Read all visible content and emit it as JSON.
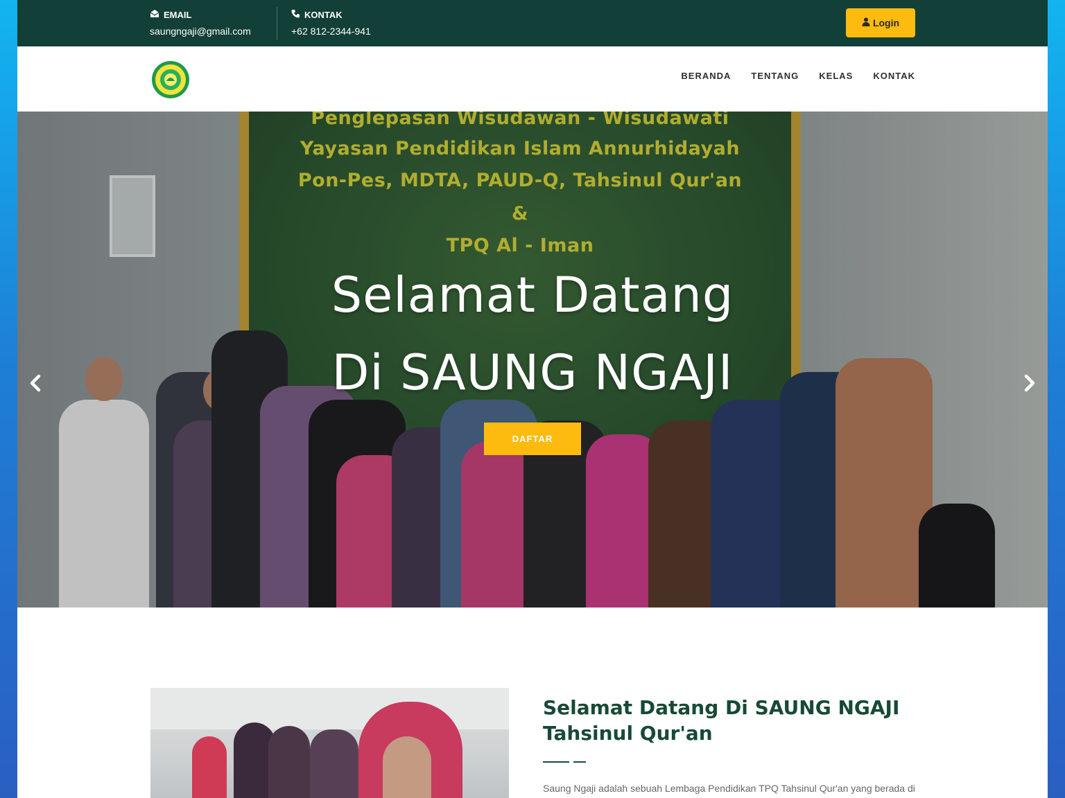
{
  "topbar": {
    "email_label": "EMAIL",
    "email_value": "saungngaji@gmail.com",
    "contact_label": "KONTAK",
    "contact_value": "+62 812-2344-941",
    "login_label": "Login"
  },
  "nav": {
    "items": [
      {
        "label": "BERANDA"
      },
      {
        "label": "TENTANG"
      },
      {
        "label": "KELAS"
      },
      {
        "label": "KONTAK"
      }
    ]
  },
  "hero": {
    "banner_lines": [
      "Penglepasan Wisudawan - Wisudawati",
      "Yayasan Pendidikan Islam Annurhidayah",
      "Pon-Pes, MDTA, PAUD-Q, Tahsinul Qur'an",
      "&",
      "TPQ Al - Iman"
    ],
    "title_line1": "Selamat Datang",
    "title_line2": "Di SAUNG NGAJI",
    "cta_label": "DAFTAR"
  },
  "about": {
    "title_line1": "Selamat Datang Di SAUNG NGAJI",
    "title_line2": "Tahsinul Qur'an",
    "text": "Saung Ngaji adalah sebuah Lembaga Pendidikan TPQ Tahsinul Qur'an yang berada di"
  },
  "colors": {
    "topbar_bg": "#123f37",
    "accent": "#fdbb10",
    "heading": "#174a35"
  },
  "icons": {
    "email": "envelope-open-icon",
    "contact": "phone-icon",
    "login": "user-icon",
    "prev": "chevron-left-icon",
    "next": "chevron-right-icon"
  }
}
